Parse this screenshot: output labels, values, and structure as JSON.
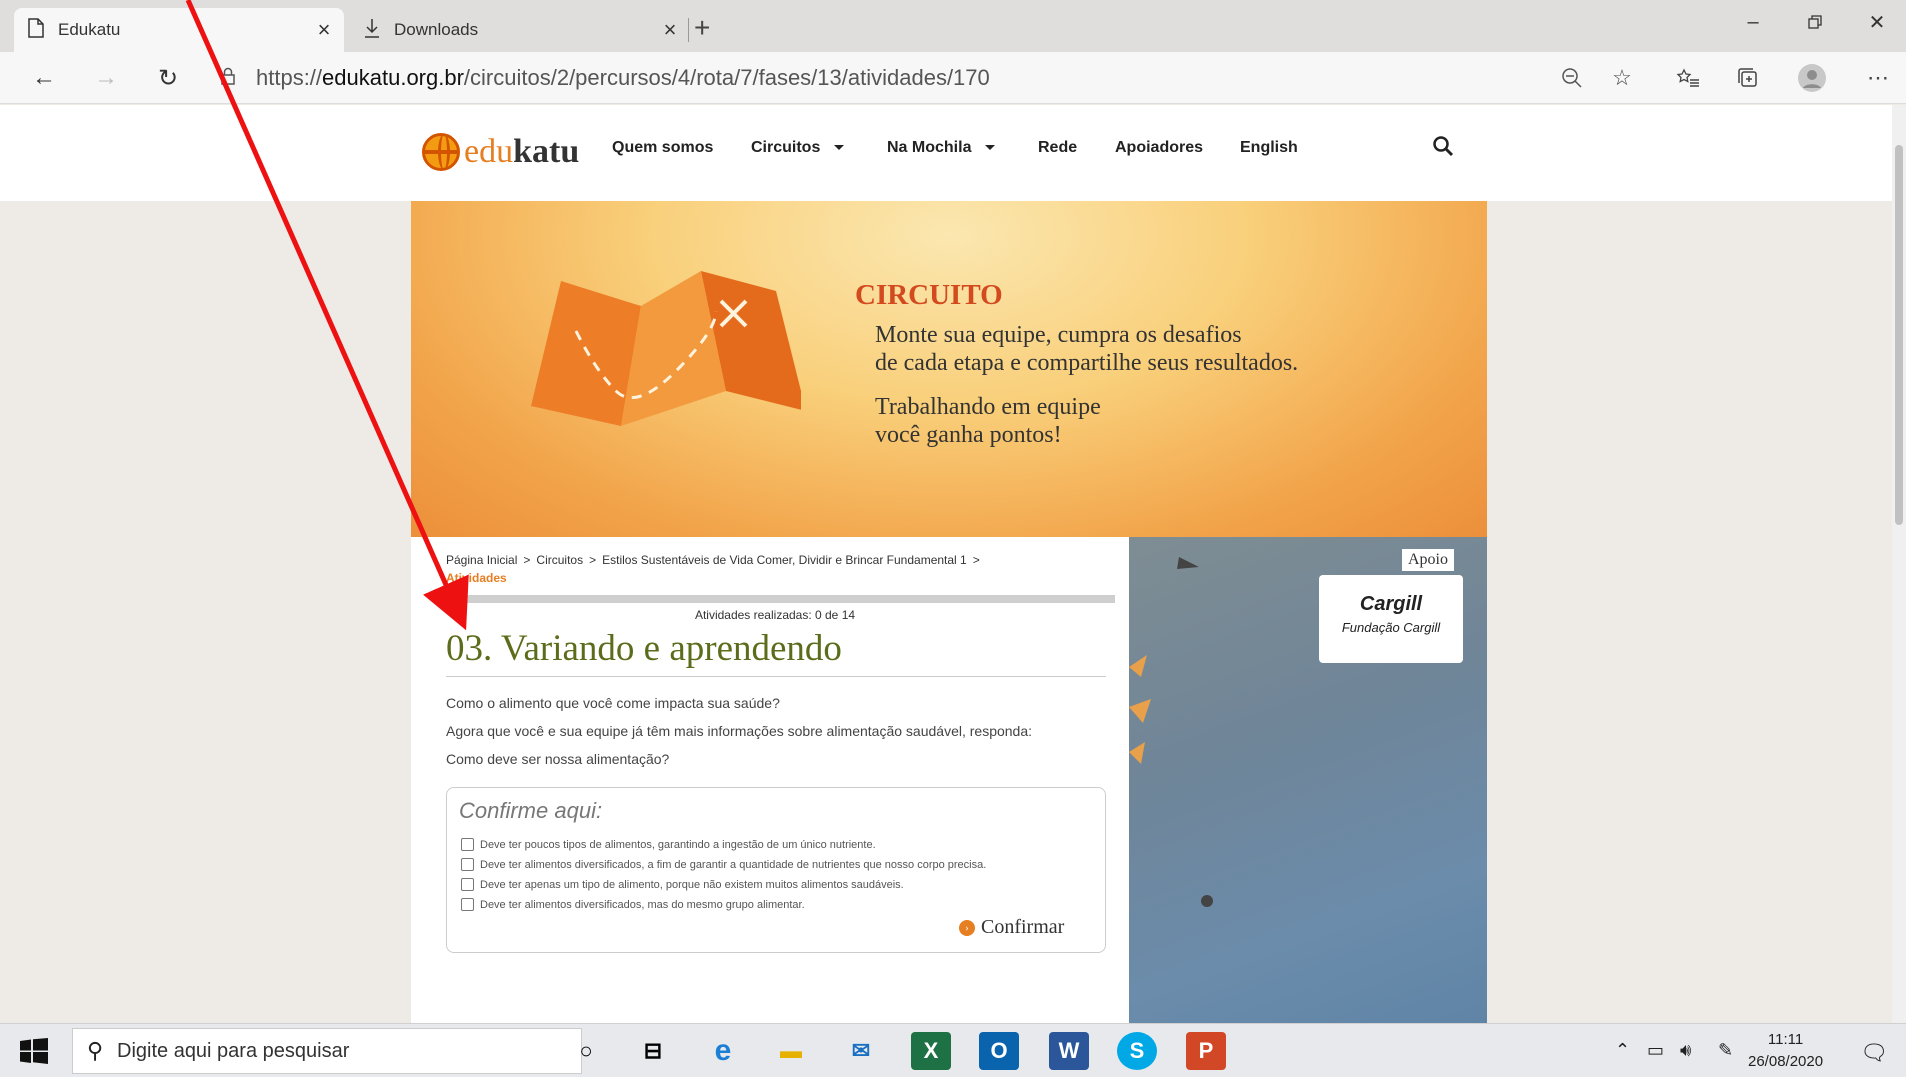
{
  "browser": {
    "tabs": [
      {
        "label": "Edukatu",
        "active": true
      },
      {
        "label": "Downloads",
        "active": false
      }
    ],
    "url_prefix": "https://",
    "url_domain": "edukatu.org.br",
    "url_path": "/circuitos/2/percursos/4/rota/7/fases/13/atividades/170"
  },
  "site": {
    "logo_edu": "edu",
    "logo_katu": "katu",
    "nav": [
      "Quem somos",
      "Circuitos",
      "Na Mochila",
      "Rede",
      "Apoiadores",
      "English"
    ]
  },
  "banner": {
    "title": "CIRCUITO",
    "line1": "Monte sua equipe, cumpra os desafios",
    "line2": "de cada etapa e compartilhe seus resultados.",
    "line3": "Trabalhando em equipe",
    "line4": "você ganha pontos!"
  },
  "breadcrumb": {
    "items": [
      "Página Inicial",
      "Circuitos",
      "Estilos Sustentáveis de Vida Comer, Dividir e Brincar Fundamental 1"
    ],
    "sep": ">",
    "current": "Atividades"
  },
  "activity": {
    "progress_text": "Atividades realizadas: 0 de 14",
    "progress_done": 0,
    "progress_total": 14,
    "title": "03. Variando e aprendendo",
    "p1": "Como o alimento que você come impacta sua saúde?",
    "p2": "Agora que você e sua equipe já têm mais informações sobre alimentação saudável, responda:",
    "p3": "Como deve ser nossa alimentação?",
    "confirm_title": "Confirme aqui:",
    "options": [
      "Deve ter poucos tipos de alimentos, garantindo a ingestão de um único nutriente.",
      "Deve ter alimentos diversificados, a fim de garantir a quantidade de nutrientes que nosso corpo precisa.",
      "Deve ter apenas um tipo de alimento, porque não existem muitos alimentos saudáveis.",
      "Deve ter alimentos diversificados, mas do mesmo grupo alimentar."
    ],
    "confirm_button": "Confirmar"
  },
  "sidebar": {
    "apoio": "Apoio",
    "sponsor_name": "Cargill",
    "sponsor_foundation": "Fundação Cargill"
  },
  "taskbar": {
    "search_placeholder": "Digite aqui para pesquisar",
    "time": "11:11",
    "date": "26/08/2020"
  },
  "colors": {
    "accent_orange": "#e67e22",
    "title_green": "#5b6d1a",
    "banner_title": "#d24a1e"
  }
}
